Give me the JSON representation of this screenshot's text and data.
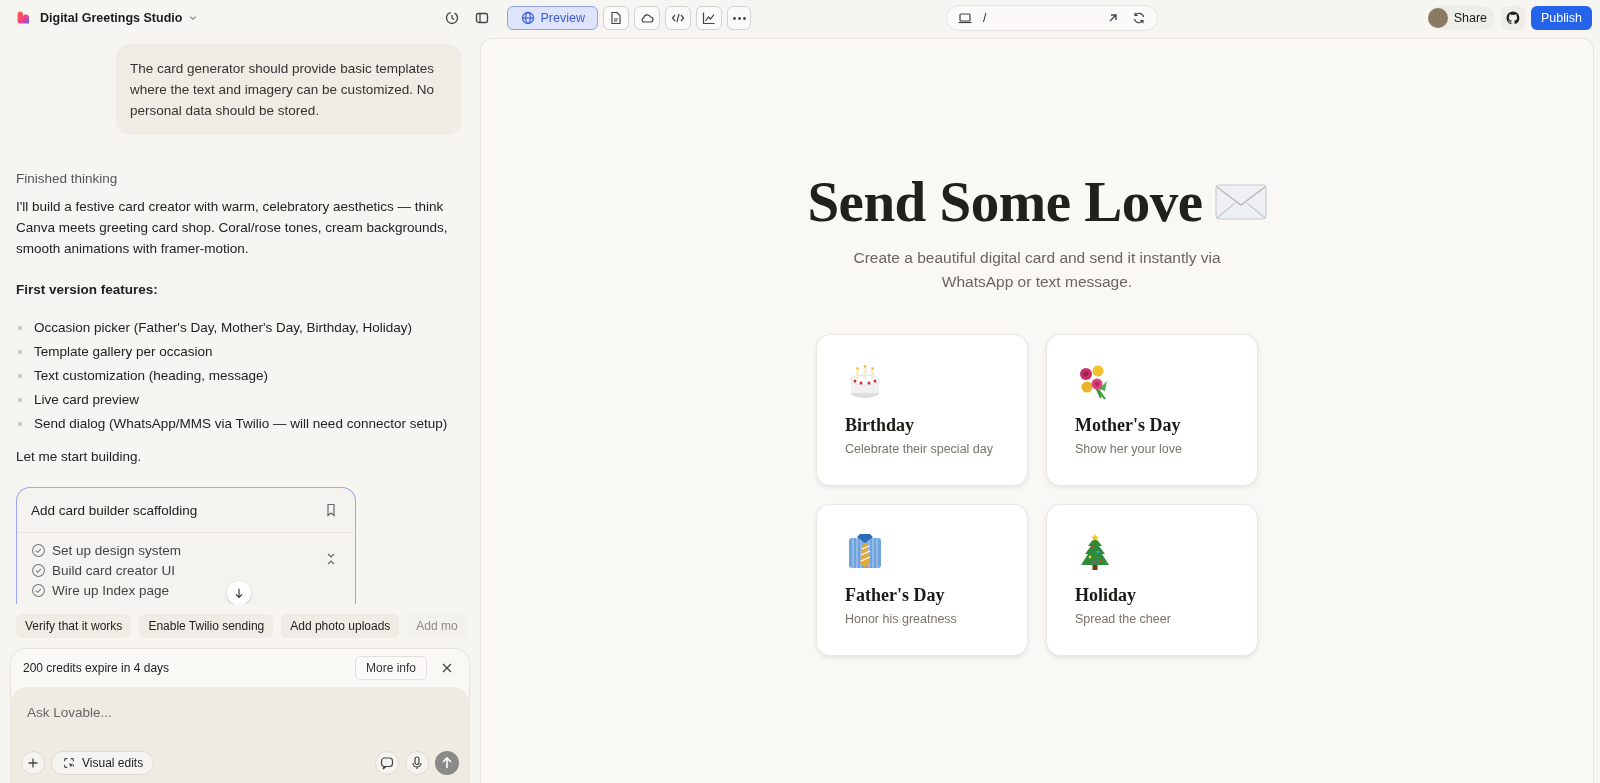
{
  "project": {
    "name": "Digital Greetings Studio"
  },
  "view_tabs": [
    {
      "kind": "globe",
      "label": "Preview",
      "selected": true
    },
    {
      "kind": "file",
      "selected": false
    },
    {
      "kind": "cloud",
      "selected": false
    },
    {
      "kind": "code",
      "selected": false
    },
    {
      "kind": "chart",
      "selected": false
    },
    {
      "kind": "more",
      "selected": false
    }
  ],
  "address_bar": {
    "path": "/"
  },
  "share_button": "Share",
  "publish_button": "Publish",
  "chat": {
    "user_message": "The card generator should provide basic templates where the text and imagery can be customized. No personal data should be stored.",
    "status": "Finished thinking",
    "intro": "I'll build a festive card creator with warm, celebratory aesthetics — think Canva meets greeting card shop. Coral/rose tones, cream backgrounds, smooth animations with framer-motion.",
    "features_heading": "First version features:",
    "features": [
      "Occasion picker (Father's Day, Mother's Day, Birthday, Holiday)",
      "Template gallery per occasion",
      "Text customization (heading, message)",
      "Live card preview",
      "Send dialog (WhatsApp/MMS via Twilio — will need connector setup)"
    ],
    "closing": "Let me start building.",
    "task": {
      "title": "Add card builder scaffolding",
      "steps": [
        {
          "label": "Set up design system",
          "done": true
        },
        {
          "label": "Build card creator UI",
          "done": true
        },
        {
          "label": "Wire up Index page",
          "done": true
        }
      ]
    },
    "suggestions": [
      "Verify that it works",
      "Enable Twilio sending",
      "Add photo uploads",
      "Add mo"
    ],
    "credits": {
      "text": "200 credits expire in 4 days",
      "button": "More info"
    },
    "input": {
      "placeholder": "Ask Lovable..."
    },
    "visual_edits": "Visual edits"
  },
  "preview": {
    "title": "Send Some Love",
    "subtitle": "Create a beautiful digital card and send it instantly via WhatsApp or text message.",
    "occasions": [
      {
        "kind": "cake",
        "title": "Birthday",
        "caption": "Celebrate their special day"
      },
      {
        "kind": "flowers",
        "title": "Mother's Day",
        "caption": "Show her your love"
      },
      {
        "kind": "shirt",
        "title": "Father's Day",
        "caption": "Honor his greatness"
      },
      {
        "kind": "tree",
        "title": "Holiday",
        "caption": "Spread the cheer"
      }
    ]
  }
}
